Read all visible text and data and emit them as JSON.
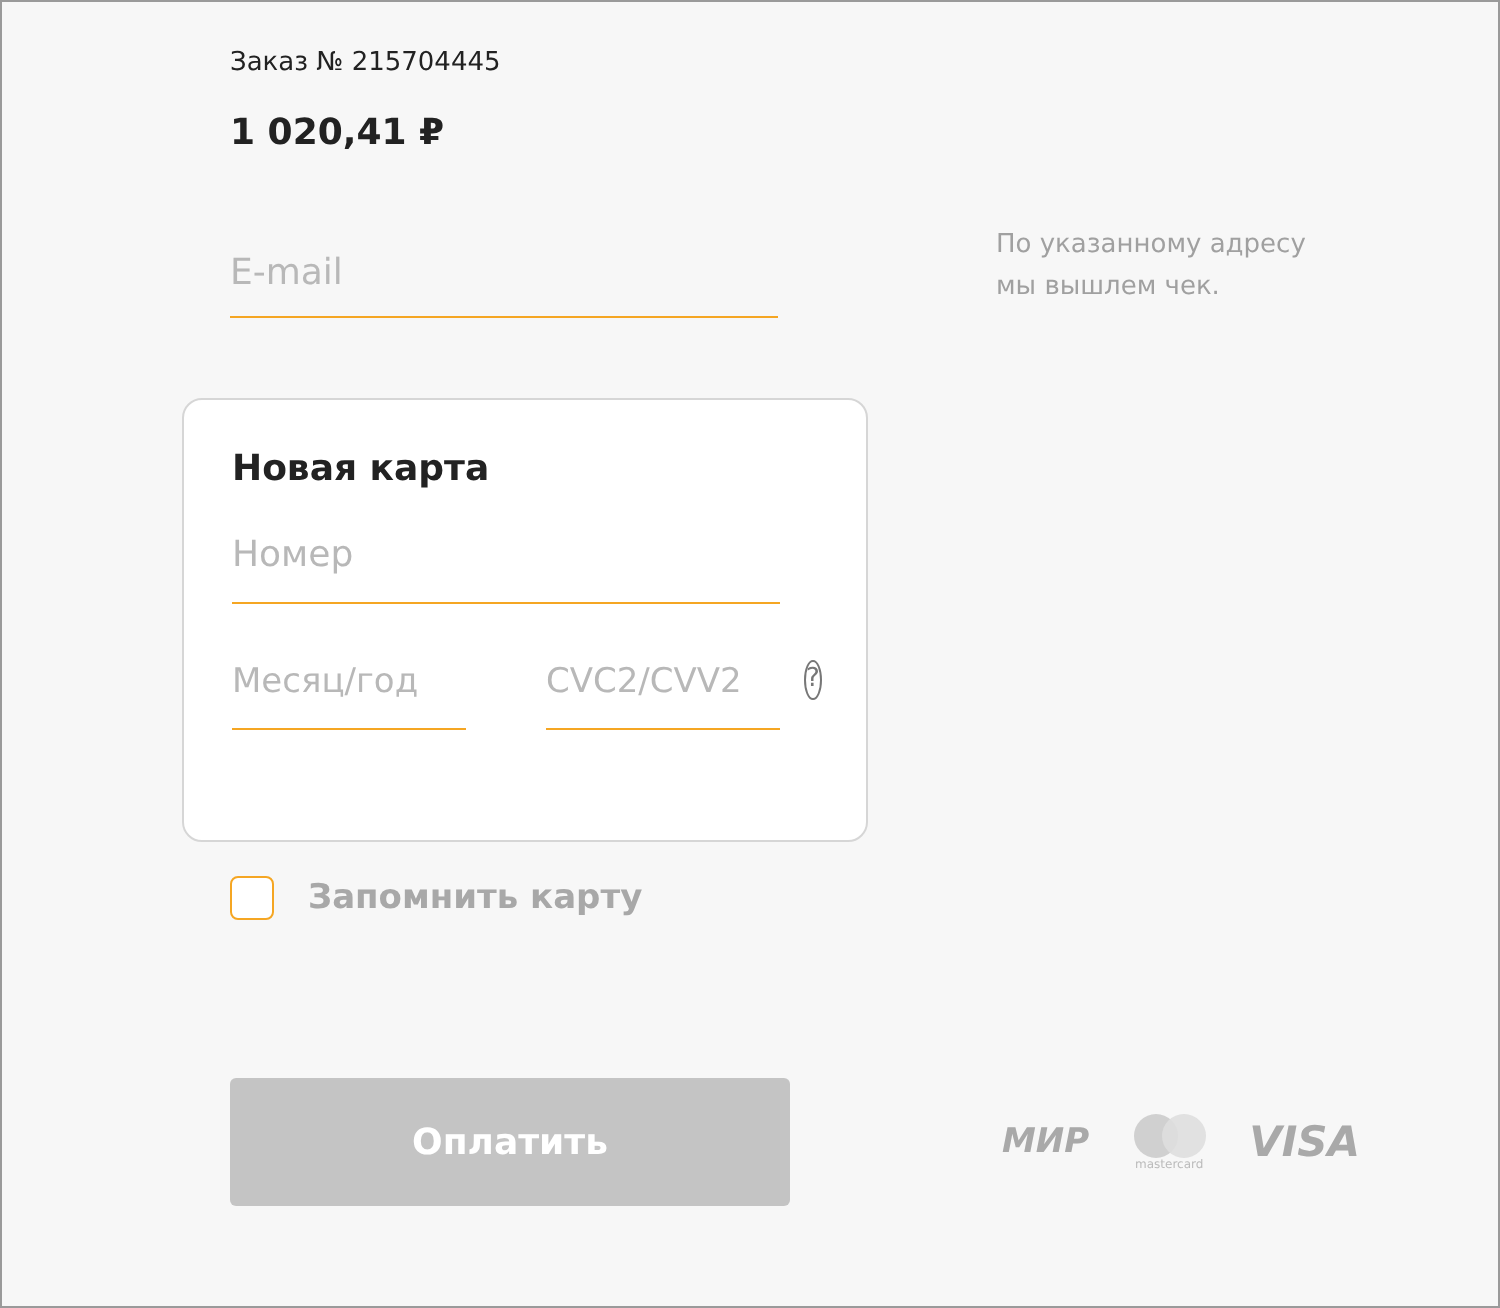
{
  "order": {
    "label": "Заказ № 215704445",
    "amount": "1 020,41 ₽"
  },
  "email": {
    "placeholder": "E-mail",
    "hint": "По указанному адресу мы вышлем чек."
  },
  "card": {
    "title": "Новая карта",
    "number": {
      "placeholder": "Номер"
    },
    "expiry": {
      "placeholder": "Месяц/год"
    },
    "cvc": {
      "placeholder": "CVC2/CVV2"
    },
    "help": "?"
  },
  "remember": {
    "label": "Запомнить карту",
    "checked": false
  },
  "pay_button": {
    "label": "Оплатить",
    "disabled": true
  },
  "payment_logos": [
    {
      "kind": "mir",
      "text": "МИР"
    },
    {
      "kind": "mastercard",
      "text": "mastercard"
    },
    {
      "kind": "visa",
      "text": "VISA"
    }
  ]
}
